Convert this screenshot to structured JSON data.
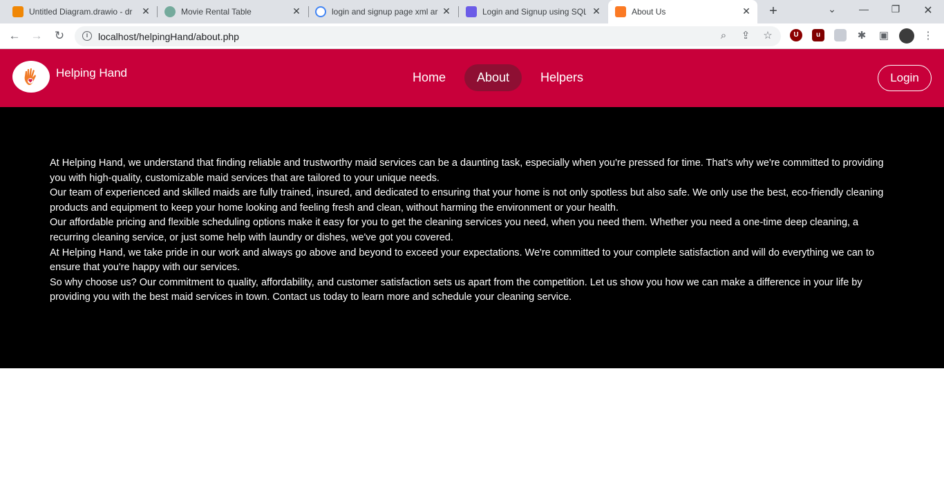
{
  "browser": {
    "tabs": [
      {
        "title": "Untitled Diagram.drawio - dr",
        "icon": "drawio-icon",
        "color": "#f08705",
        "active": false
      },
      {
        "title": "Movie Rental Table",
        "icon": "chatgpt-icon",
        "color": "#74aa9c",
        "active": false
      },
      {
        "title": "login and signup page xml ar",
        "icon": "google-icon",
        "color": "#4285f4",
        "active": false
      },
      {
        "title": "Login and Signup using SQLi",
        "icon": "site-icon",
        "color": "#6b5ce7",
        "active": false
      },
      {
        "title": "About Us",
        "icon": "xampp-icon",
        "color": "#fb7a24",
        "active": true
      }
    ],
    "url": "localhost/helpingHand/about.php"
  },
  "site": {
    "brand": "Helping Hand",
    "nav": [
      {
        "label": "Home",
        "active": false
      },
      {
        "label": "About",
        "active": true
      },
      {
        "label": "Helpers",
        "active": false
      }
    ],
    "login_label": "Login",
    "header_color": "#c8003a",
    "active_nav_color": "#8e0f33"
  },
  "about": {
    "paragraphs": [
      "At Helping Hand, we understand that finding reliable and trustworthy maid services can be a daunting task, especially when you're pressed for time. That's why we're committed to providing you with high-quality, customizable maid services that are tailored to your unique needs.",
      "Our team of experienced and skilled maids are fully trained, insured, and dedicated to ensuring that your home is not only spotless but also safe. We only use the best, eco-friendly cleaning products and equipment to keep your home looking and feeling fresh and clean, without harming the environment or your health.",
      "Our affordable pricing and flexible scheduling options make it easy for you to get the cleaning services you need, when you need them. Whether you need a one-time deep cleaning, a recurring cleaning service, or just some help with laundry or dishes, we've got you covered.",
      "At Helping Hand, we take pride in our work and always go above and beyond to exceed your expectations. We're committed to your complete satisfaction and will do everything we can to ensure that you're happy with our services.",
      "So why choose us? Our commitment to quality, affordability, and customer satisfaction sets us apart from the competition. Let us show you how we can make a difference in your life by providing you with the best maid services in town. Contact us today to learn more and schedule your cleaning service."
    ]
  }
}
